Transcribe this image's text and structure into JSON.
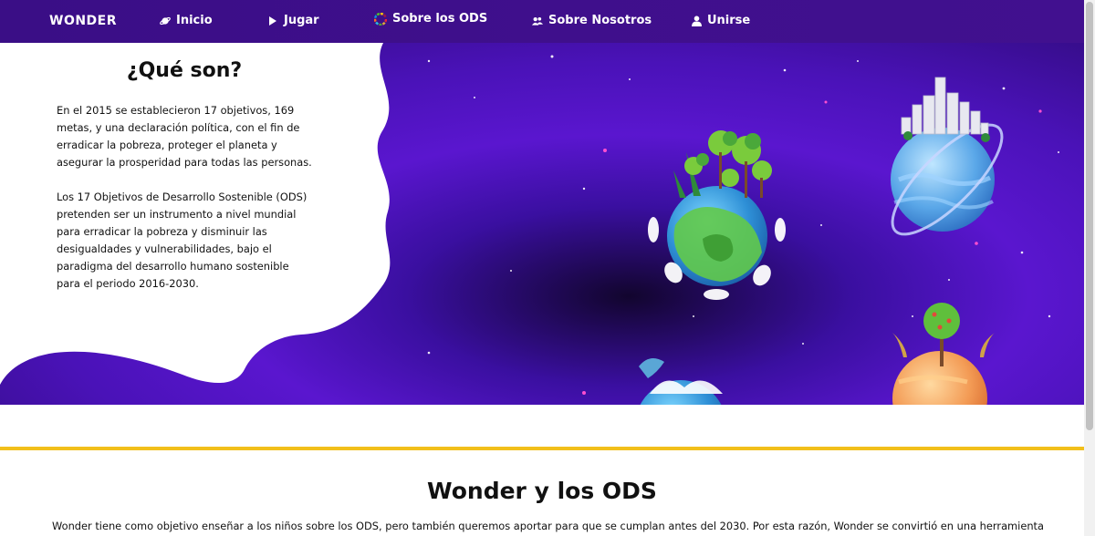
{
  "nav": {
    "brand": "WONDER",
    "items": [
      {
        "label": "Inicio",
        "icon": "planet-icon"
      },
      {
        "label": "Jugar",
        "icon": "play-icon"
      },
      {
        "label": "Sobre los ODS",
        "icon": "ods-wheel-icon"
      },
      {
        "label": "Sobre Nosotros",
        "icon": "group-icon"
      },
      {
        "label": "Unirse",
        "icon": "user-icon"
      }
    ]
  },
  "hero": {
    "title": "¿Qué son?",
    "paragraph1": "En el 2015 se establecieron 17 objetivos, 169 metas, y una declaración política, con el fin de erradicar la pobreza, proteger el planeta y asegurar la prosperidad para todas las personas.",
    "paragraph2": "Los 17 Objetivos de Desarrollo Sostenible (ODS) pretenden ser un instrumento a nivel mundial para erradicar la pobreza y disminuir las desigualdades y vulnerabilidades, bajo el paradigma del desarrollo humano sostenible para el periodo 2016-2030."
  },
  "section": {
    "title": "Wonder y los ODS",
    "text": "Wonder tiene como objetivo enseñar a los niños sobre los ODS, pero también queremos aportar para que se cumplan antes del 2030. Por esta razón, Wonder se convirtió en una herramienta"
  },
  "colors": {
    "nav": "#3f0f8c",
    "accent_line": "#f2bf1a",
    "space": "#4a12b8"
  }
}
